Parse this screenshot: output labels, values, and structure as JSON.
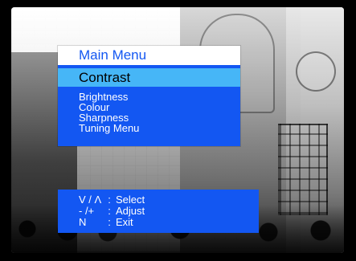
{
  "menu": {
    "title": "Main Menu",
    "selected": "Contrast",
    "items": [
      "Brightness",
      "Colour",
      "Sharpness",
      "Tuning Menu"
    ]
  },
  "help": {
    "rows": [
      {
        "key": "V / Λ",
        "sep": ":",
        "action": "Select"
      },
      {
        "key": "- /+",
        "sep": ":",
        "action": "Adjust"
      },
      {
        "key": "N",
        "sep": ":",
        "action": "Exit"
      }
    ]
  },
  "colors": {
    "menu_blue": "#1357f2",
    "menu_selected_blue": "#46b6f7",
    "menu_title_bg": "#ffffff"
  }
}
